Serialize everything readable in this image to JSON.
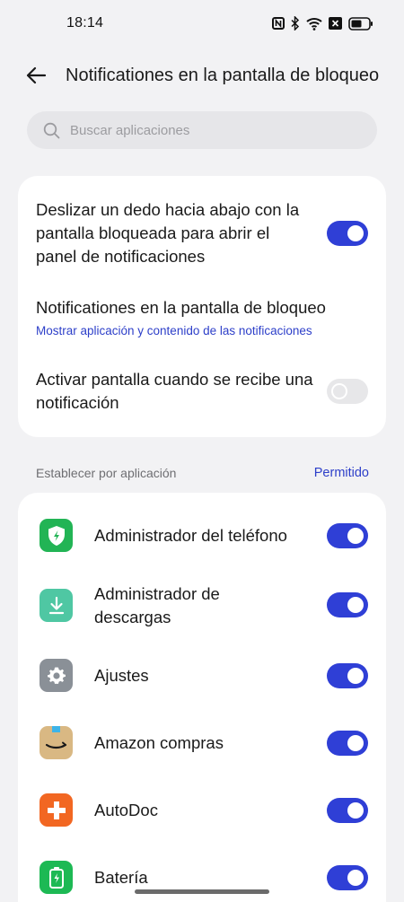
{
  "status_bar": {
    "time": "18:14"
  },
  "header": {
    "title": "Notificationes en la pantalla de bloqueo"
  },
  "search": {
    "placeholder": "Buscar aplicaciones"
  },
  "settings": [
    {
      "title": "Deslizar un dedo hacia abajo con la pantalla bloqueada para abrir el panel de notificaciones",
      "enabled": true
    },
    {
      "title": "Notificationes en la pantalla de bloqueo",
      "subtitle": "Mostrar aplicación y contenido de las notificaciones"
    },
    {
      "title": "Activar pantalla cuando se recibe una notificación",
      "enabled": false
    }
  ],
  "apps_section": {
    "label": "Establecer por aplicación",
    "action": "Permitido"
  },
  "apps": [
    {
      "name": "Administrador del teléfono",
      "icon": "phone-manager-icon",
      "color": "#22b455",
      "enabled": true
    },
    {
      "name": "Administrador de descargas",
      "icon": "download-manager-icon",
      "color": "#4fc7a3",
      "enabled": true
    },
    {
      "name": "Ajustes",
      "icon": "settings-gear-icon",
      "color": "#8a9097",
      "enabled": true
    },
    {
      "name": "Amazon compras",
      "icon": "amazon-icon",
      "color": "#d9b883",
      "enabled": true
    },
    {
      "name": "AutoDoc",
      "icon": "autodoc-icon",
      "color": "#f26722",
      "enabled": true
    },
    {
      "name": "Batería",
      "icon": "battery-icon",
      "color": "#1db954",
      "enabled": true
    }
  ],
  "colors": {
    "accent": "#2f3fd6",
    "link": "#2d3fc9",
    "background": "#f2f2f4"
  }
}
